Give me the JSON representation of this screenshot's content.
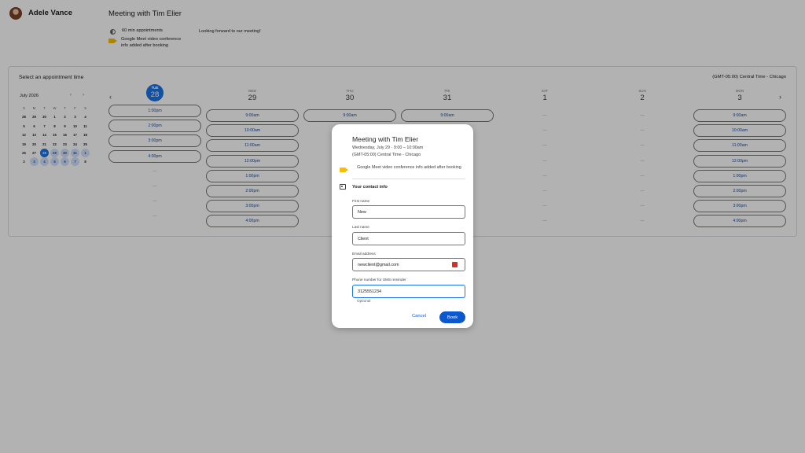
{
  "host": {
    "name": "Adele Vance"
  },
  "meeting": {
    "title": "Meeting with Tim Elier",
    "duration": "60 min appointments",
    "meet_info": "Google Meet video conference info added after booking",
    "description": "Looking forward to our meeting!"
  },
  "panel": {
    "title": "Select an appointment time",
    "timezone": "(GMT-05:00) Central Time - Chicago"
  },
  "mini_calendar": {
    "month": "July 2026",
    "prev": "‹",
    "next": "›",
    "dow": [
      "S",
      "M",
      "T",
      "W",
      "T",
      "F",
      "S"
    ],
    "weeks": [
      [
        "28",
        "29",
        "30",
        "1",
        "2",
        "3",
        "4"
      ],
      [
        "5",
        "6",
        "7",
        "8",
        "9",
        "10",
        "11"
      ],
      [
        "12",
        "13",
        "14",
        "15",
        "16",
        "17",
        "18"
      ],
      [
        "19",
        "20",
        "21",
        "22",
        "23",
        "24",
        "25"
      ],
      [
        "26",
        "27",
        "28",
        "29",
        "30",
        "31",
        "1"
      ],
      [
        "2",
        "3",
        "4",
        "5",
        "6",
        "7",
        "8"
      ]
    ],
    "selected": "28",
    "available": [
      "29",
      "30",
      "31",
      "1",
      "3",
      "4",
      "5",
      "6",
      "7"
    ]
  },
  "week": {
    "prev": "‹",
    "next": "›",
    "days": [
      {
        "dow": "TUE",
        "num": "28",
        "today": true,
        "slots": [
          "1:00pm",
          "2:00pm",
          "3:00pm",
          "4:00pm",
          "—",
          "—",
          "—",
          "—"
        ]
      },
      {
        "dow": "WED",
        "num": "29",
        "today": false,
        "slots": [
          "9:00am",
          "10:00am",
          "11:00am",
          "12:00pm",
          "1:00pm",
          "2:00pm",
          "3:00pm",
          "4:00pm"
        ]
      },
      {
        "dow": "THU",
        "num": "30",
        "today": false,
        "slots": [
          "9:00am",
          "",
          "",
          "",
          "",
          "",
          "",
          ""
        ]
      },
      {
        "dow": "FRI",
        "num": "31",
        "today": false,
        "slots": [
          "9:00am",
          "",
          "",
          "",
          "",
          "",
          "",
          ""
        ]
      },
      {
        "dow": "SAT",
        "num": "1",
        "today": false,
        "slots": [
          "—",
          "—",
          "—",
          "—",
          "—",
          "—",
          "—",
          "—"
        ]
      },
      {
        "dow": "SUN",
        "num": "2",
        "today": false,
        "slots": [
          "—",
          "—",
          "—",
          "—",
          "—",
          "—",
          "—",
          "—"
        ]
      },
      {
        "dow": "MON",
        "num": "3",
        "today": false,
        "slots": [
          "9:00am",
          "10:00am",
          "11:00am",
          "12:00pm",
          "1:00pm",
          "2:00pm",
          "3:00pm",
          "4:00pm"
        ]
      }
    ]
  },
  "dialog": {
    "title": "Meeting with Tim Elier",
    "date_line": "Wednesday, July 29 · 9:00 – 10:00am",
    "tz_line": "(GMT-05:00) Central Time - Chicago",
    "meet_info": "Google Meet video conference info added after booking",
    "contact_heading": "Your contact info",
    "first_name_label": "First name",
    "first_name_value": "New",
    "last_name_label": "Last name",
    "last_name_value": "Client",
    "email_label": "Email address",
    "email_value": "newclient@gmail.com",
    "phone_label": "Phone number for SMS reminder",
    "phone_value": "3125551234",
    "phone_hint": "Optional",
    "cancel": "Cancel",
    "book": "Book"
  },
  "colors": {
    "accent": "#0b57d0",
    "today": "#1a73e8",
    "meet": "#fbbc04"
  }
}
